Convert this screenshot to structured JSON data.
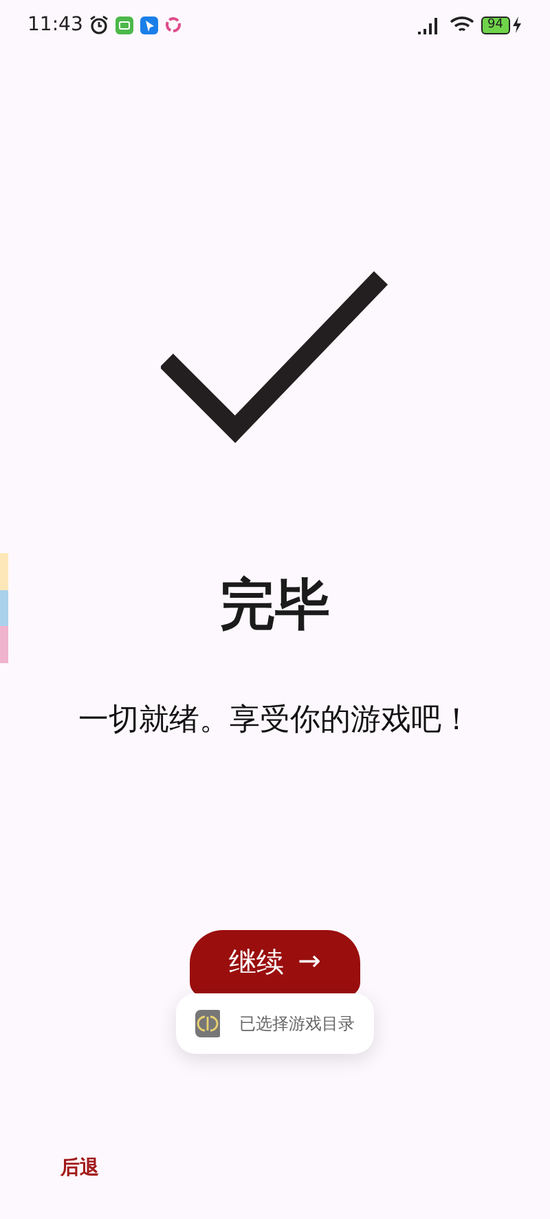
{
  "status_bar": {
    "time": "11:43",
    "battery": "94"
  },
  "title": "完毕",
  "message": "一切就绪。享受你的游戏吧！",
  "continue_button": {
    "label": "继续",
    "arrow": "→"
  },
  "toast": {
    "text": "已选择游戏目录"
  },
  "back_button": {
    "label": "后退"
  }
}
